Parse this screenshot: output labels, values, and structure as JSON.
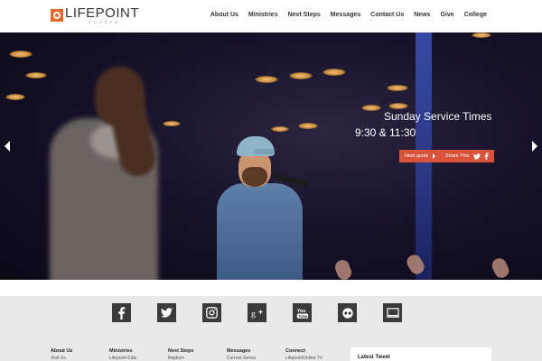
{
  "header": {
    "logo_text": "LIFEPOINT",
    "logo_sub": "CHURCH",
    "nav": [
      "About Us",
      "Ministries",
      "Next Steps",
      "Messages",
      "Contact Us",
      "News",
      "Give",
      "College"
    ]
  },
  "hero": {
    "title": "Sunday Service Times",
    "times": "9:30 & 11:30",
    "next_quote_label": "Next quote",
    "share_label": "Share This"
  },
  "social": {
    "icons": [
      "facebook-icon",
      "twitter-icon",
      "instagram-icon",
      "google-plus-icon",
      "youtube-icon",
      "flickr-icon",
      "tv-icon"
    ]
  },
  "footer": {
    "columns": [
      {
        "title": "About Us",
        "link": "Visit Us"
      },
      {
        "title": "Ministries",
        "link": "Lifepoint Kids"
      },
      {
        "title": "Next Steps",
        "link": "Baptism"
      },
      {
        "title": "Messages",
        "link": "Current Series"
      },
      {
        "title": "Connect",
        "link": "LifepointOnline.TV"
      }
    ],
    "tweet_title": "Latest Tweet"
  },
  "colors": {
    "accent": "#d9533a",
    "logo": "#e8692c",
    "footer_bg": "#e9e9e9",
    "icon_bg": "#3a3a3a"
  }
}
